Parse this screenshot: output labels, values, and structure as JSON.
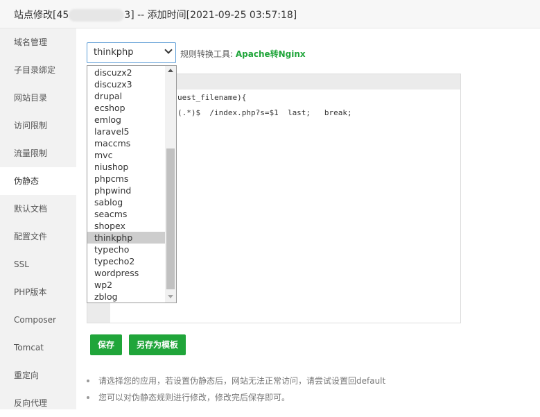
{
  "title": {
    "prefix": "站点修改[45",
    "suffix": "3] -- 添加时间[2021-09-25 03:57:18]"
  },
  "sidebar": {
    "items": [
      "域名管理",
      "子目录绑定",
      "网站目录",
      "访问限制",
      "流量限制",
      "伪静态",
      "默认文档",
      "配置文件",
      "SSL",
      "PHP版本",
      "Composer",
      "Tomcat",
      "重定向",
      "反向代理"
    ],
    "active": "伪静态"
  },
  "rewrite": {
    "selected": "thinkphp",
    "tool_label": "规则转换工具: ",
    "tool_link": "Apache转Nginx"
  },
  "editor": {
    "line1": "uest_filename){",
    "line2": "(.*)$  /index.php?s=$1  last;   break;"
  },
  "dropdown": {
    "options": [
      "discuzx2",
      "discuzx3",
      "drupal",
      "ecshop",
      "emlog",
      "laravel5",
      "maccms",
      "mvc",
      "niushop",
      "phpcms",
      "phpwind",
      "sablog",
      "seacms",
      "shopex",
      "thinkphp",
      "typecho",
      "typecho2",
      "wordpress",
      "wp2",
      "zblog"
    ],
    "selected": "thinkphp"
  },
  "buttons": {
    "save": "保存",
    "save_template": "另存为模板"
  },
  "tips": [
    "请选择您的应用，若设置伪静态后，网站无法正常访问，请尝试设置回default",
    "您可以对伪静态规则进行修改，修改完后保存即可。"
  ]
}
